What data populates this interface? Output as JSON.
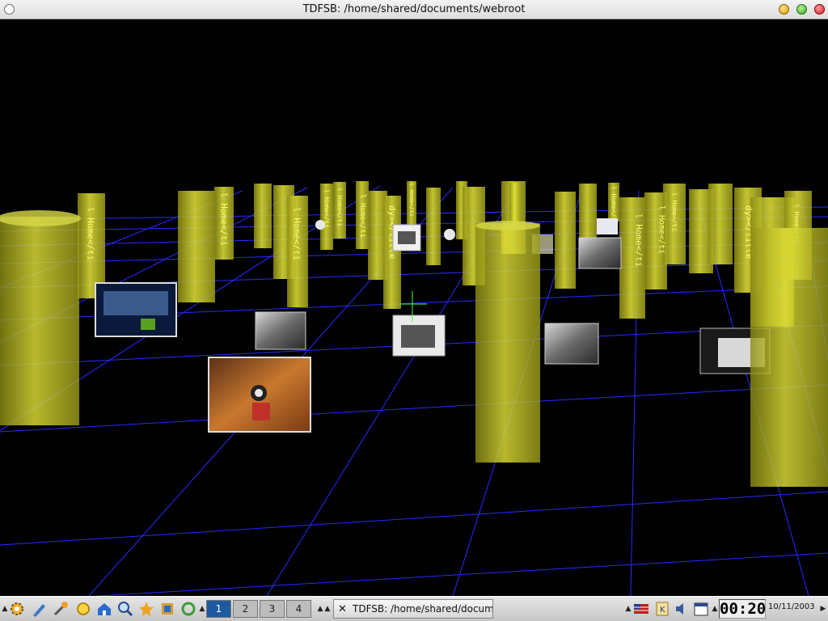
{
  "window": {
    "title": "TDFSB: /home/shared/documents/webroot"
  },
  "scene": {
    "background": "#000000",
    "grid_color": "#2a2aff",
    "pillar_color": "#e6e63a",
    "pillar_label": "l Home</ti",
    "pillar_label_alt": "dy></title",
    "cursor_color": "#40ff40"
  },
  "taskbar": {
    "launchers": [
      "gear-icon",
      "pen-icon",
      "wrench-icon",
      "gear-yellow-icon",
      "home-icon",
      "search-icon",
      "star-icon",
      "flag-icon",
      "recycle-icon"
    ],
    "workspaces": [
      "1",
      "2",
      "3",
      "4"
    ],
    "active_workspace": "1",
    "task_title": "TDFSB: /home/shared/docume",
    "tray_icons": [
      "flag-icon",
      "k-icon",
      "speaker-icon",
      "calendar-icon"
    ],
    "clock": "00:20",
    "date": "10/11/2003"
  }
}
